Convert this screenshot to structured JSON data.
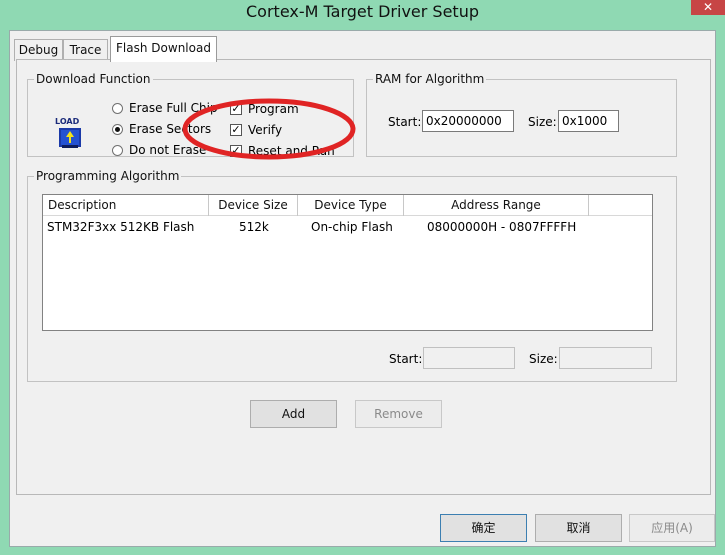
{
  "window": {
    "title": "Cortex-M Target Driver Setup",
    "close_glyph": "✕"
  },
  "tabs": [
    {
      "label": "Debug"
    },
    {
      "label": "Trace"
    },
    {
      "label": "Flash Download"
    }
  ],
  "download_function": {
    "title": "Download Function",
    "radios": [
      {
        "label": "Erase Full Chip",
        "selected": false
      },
      {
        "label": "Erase Sectors",
        "selected": true
      },
      {
        "label": "Do not Erase",
        "selected": false
      }
    ],
    "checks": [
      {
        "label": "Program",
        "checked": true
      },
      {
        "label": "Verify",
        "checked": true
      },
      {
        "label": "Reset and Run",
        "checked": true
      }
    ],
    "icon_text": "LOAD"
  },
  "ram": {
    "title": "RAM for Algorithm",
    "start_label": "Start:",
    "start_value": "0x20000000",
    "size_label": "Size:",
    "size_value": "0x1000"
  },
  "algorithm": {
    "title": "Programming Algorithm",
    "columns": [
      "Description",
      "Device Size",
      "Device Type",
      "Address Range"
    ],
    "rows": [
      {
        "description": "STM32F3xx 512KB Flash",
        "size": "512k",
        "type": "On-chip Flash",
        "range": "08000000H - 0807FFFFH"
      }
    ],
    "start_label": "Start:",
    "start_value": "",
    "size_label": "Size:",
    "size_value": ""
  },
  "buttons": {
    "add": "Add",
    "remove": "Remove",
    "ok": "确定",
    "cancel": "取消",
    "apply": "应用(A)"
  },
  "colors": {
    "titlebar": "#8fd9b3",
    "annotation": "#e02424"
  }
}
